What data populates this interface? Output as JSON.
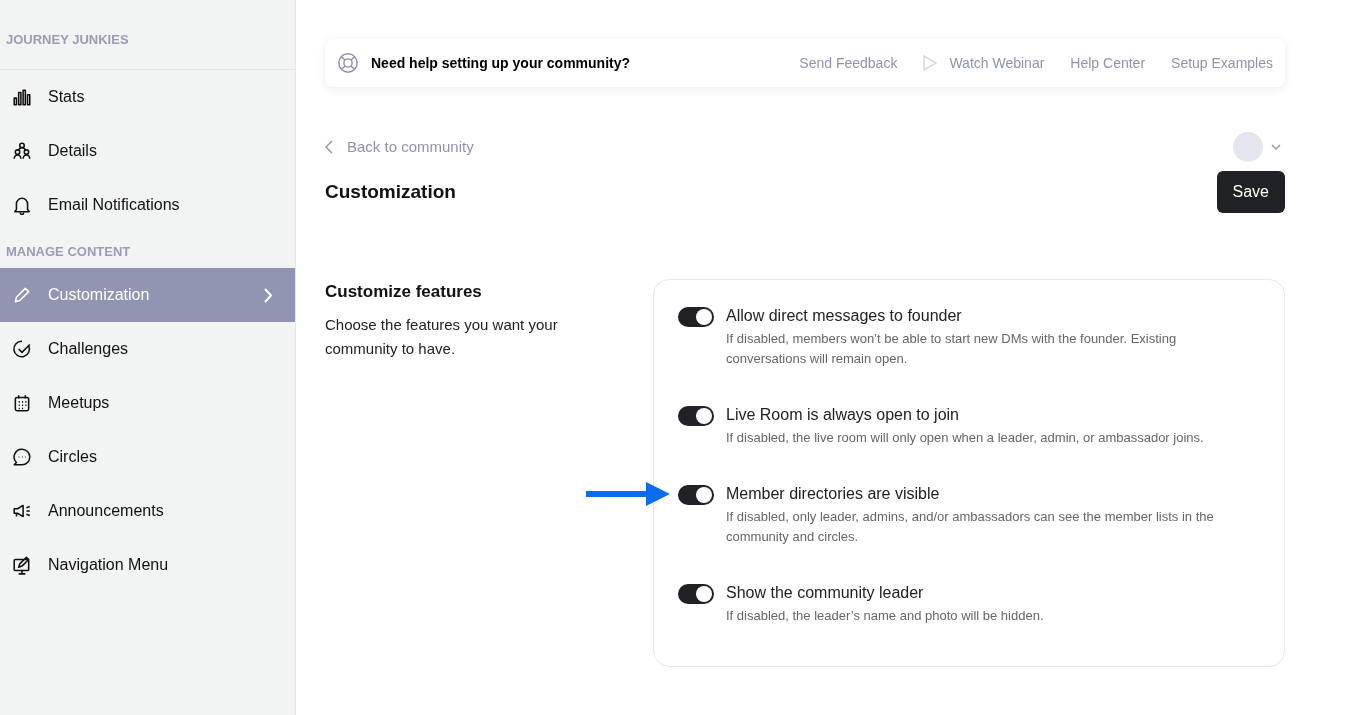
{
  "sidebar": {
    "sections": [
      {
        "heading": "JOURNEY JUNKIES",
        "items": [
          {
            "label": "Stats",
            "selected": false
          },
          {
            "label": "Details",
            "selected": false
          },
          {
            "label": "Email Notifications",
            "selected": false
          }
        ]
      },
      {
        "heading": "MANAGE CONTENT",
        "items": [
          {
            "label": "Customization",
            "selected": true
          },
          {
            "label": "Challenges",
            "selected": false
          },
          {
            "label": "Meetups",
            "selected": false
          },
          {
            "label": "Circles",
            "selected": false
          },
          {
            "label": "Announcements",
            "selected": false
          },
          {
            "label": "Navigation Menu",
            "selected": false
          }
        ]
      }
    ]
  },
  "help_bar": {
    "text": "Need help setting up your community?",
    "links": [
      "Send Feedback",
      "Watch Webinar",
      "Help Center",
      "Setup Examples"
    ]
  },
  "back_link": "Back to community",
  "page_title": "Customization",
  "save_button": "Save",
  "features_section": {
    "title": "Customize features",
    "description": "Choose the features you want your community to have.",
    "features": [
      {
        "label": "Allow direct messages to founder",
        "description": "If disabled, members won’t be able to start new DMs with the founder. Existing conversations will remain open.",
        "on": true,
        "highlighted": false
      },
      {
        "label": "Live Room is always open to join",
        "description": "If disabled, the live room will only open when a leader, admin, or ambassador joins.",
        "on": true,
        "highlighted": false
      },
      {
        "label": "Member directories are visible",
        "description": "If disabled, only leader, admins, and/or ambassadors can see the member lists in the community and circles.",
        "on": true,
        "highlighted": true
      },
      {
        "label": "Show the community leader",
        "description": "If disabled, the leader’s name and photo will be hidden.",
        "on": true,
        "highlighted": false
      }
    ]
  }
}
